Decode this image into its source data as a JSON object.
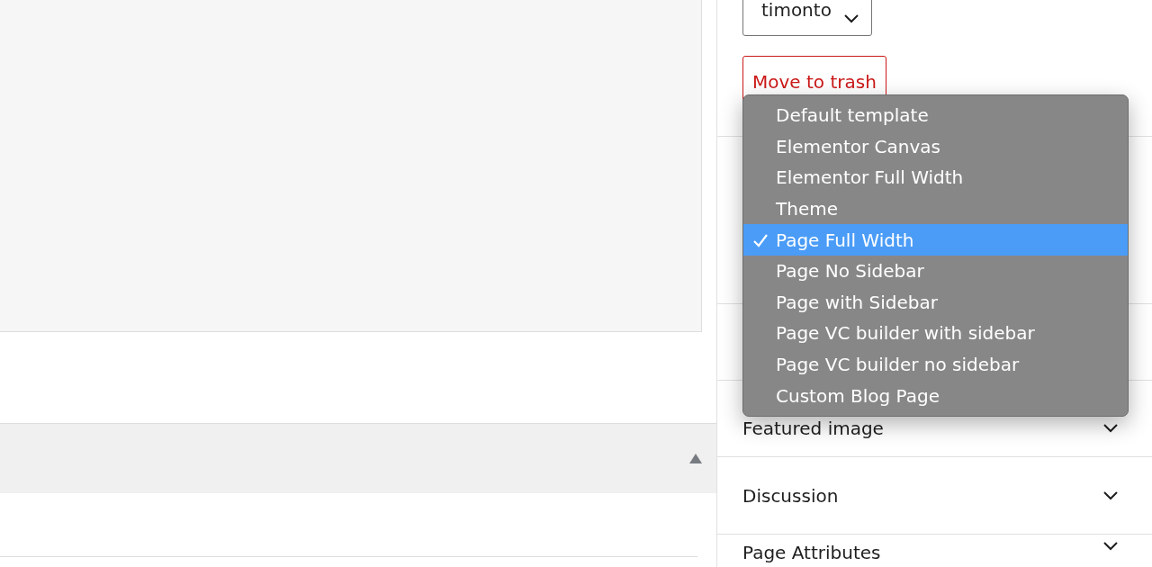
{
  "author_select": {
    "value": "timonto"
  },
  "trash_button": {
    "label": "Move to trash"
  },
  "template_menu": {
    "options": [
      {
        "label": "Default template",
        "selected": false
      },
      {
        "label": "Elementor Canvas",
        "selected": false
      },
      {
        "label": "Elementor Full Width",
        "selected": false
      },
      {
        "label": "Theme",
        "selected": false
      },
      {
        "label": "Page Full Width",
        "selected": true
      },
      {
        "label": "Page No Sidebar",
        "selected": false
      },
      {
        "label": "Page with Sidebar",
        "selected": false
      },
      {
        "label": "Page VC builder with sidebar",
        "selected": false
      },
      {
        "label": "Page VC builder no sidebar",
        "selected": false
      },
      {
        "label": "Custom Blog Page",
        "selected": false
      }
    ]
  },
  "panels": [
    {
      "title": "Featured image"
    },
    {
      "title": "Discussion"
    },
    {
      "title": "Page Attributes"
    }
  ]
}
